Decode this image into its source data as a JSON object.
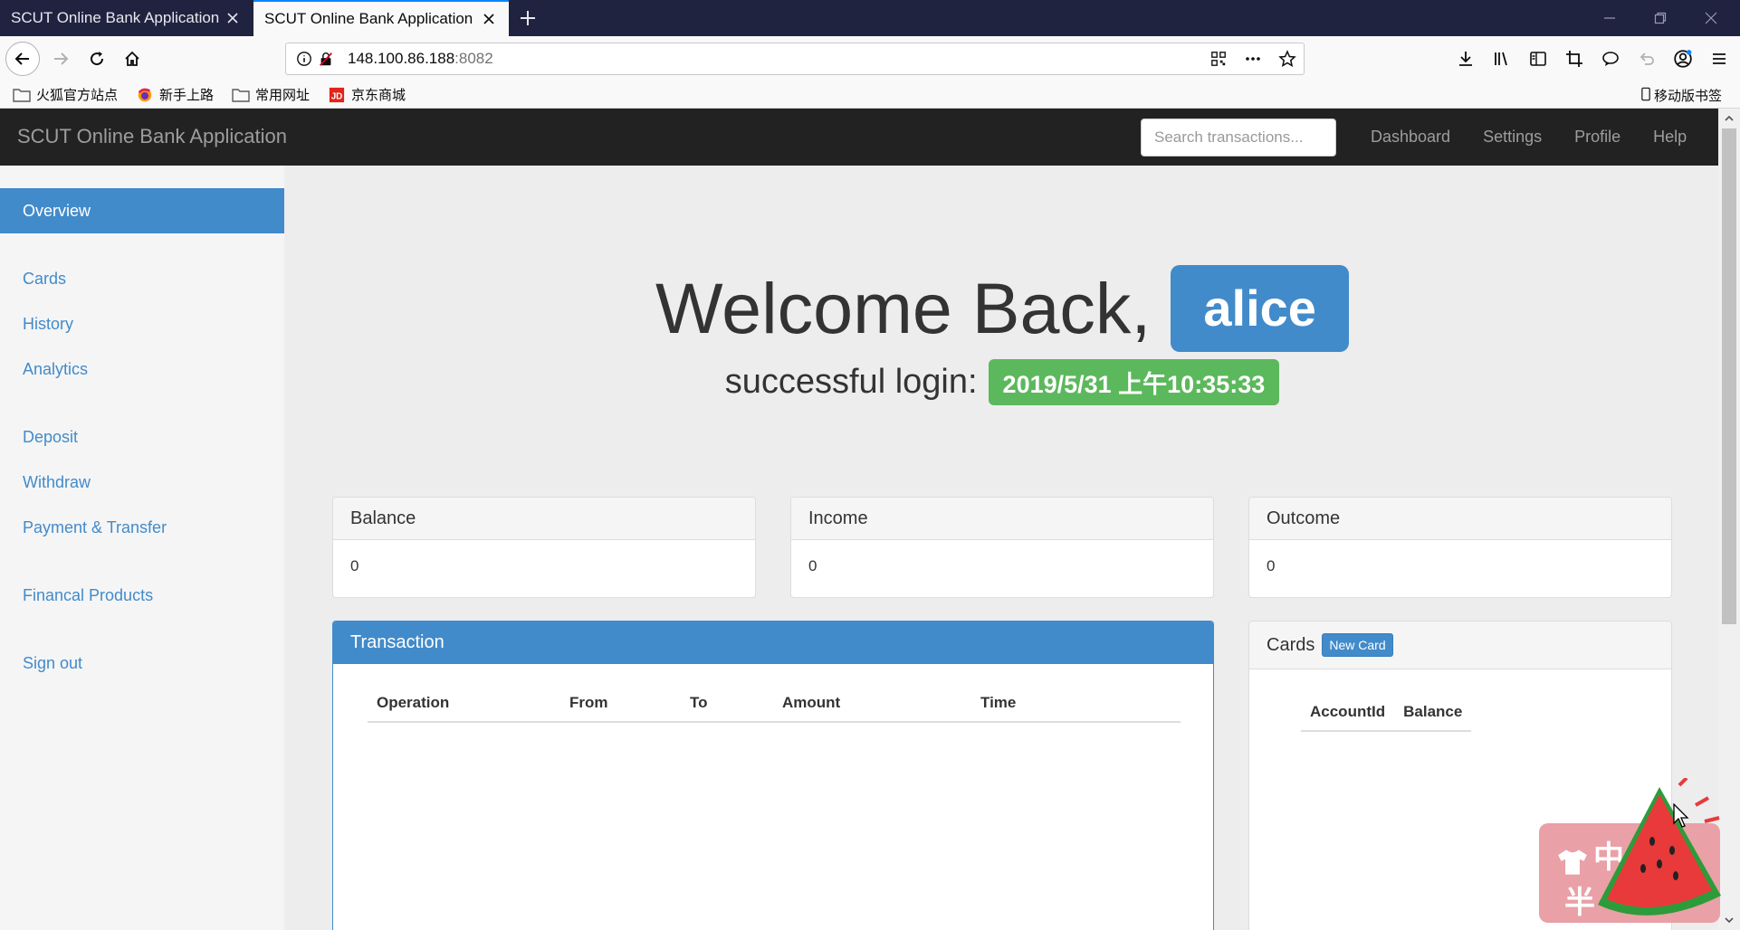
{
  "browser": {
    "tabs": [
      {
        "title": "SCUT Online Bank Application"
      },
      {
        "title": "SCUT Online Bank Application"
      }
    ],
    "url": {
      "host": "148.100.86.188",
      "port": ":8082"
    },
    "bookmarks": [
      {
        "label": "火狐官方站点",
        "icon": "folder-icon"
      },
      {
        "label": "新手上路",
        "icon": "firefox-icon"
      },
      {
        "label": "常用网址",
        "icon": "folder-icon"
      },
      {
        "label": "京东商城",
        "icon": "jd-icon"
      }
    ],
    "mobile_bookmarks": "移动版书签"
  },
  "app": {
    "brand": "SCUT Online Bank Application",
    "search_placeholder": "Search transactions...",
    "top_links": [
      "Dashboard",
      "Settings",
      "Profile",
      "Help"
    ]
  },
  "sidebar": {
    "items": [
      {
        "label": "Overview",
        "active": true
      },
      {
        "label": "Cards"
      },
      {
        "label": "History"
      },
      {
        "label": "Analytics"
      },
      {
        "label": "Deposit"
      },
      {
        "label": "Withdraw"
      },
      {
        "label": "Payment & Transfer"
      },
      {
        "label": "Financal Products"
      },
      {
        "label": "Sign out"
      }
    ]
  },
  "welcome": {
    "greeting": "Welcome Back,",
    "username": "alice",
    "login_label": "successful login:",
    "login_time": "2019/5/31 上午10:35:33"
  },
  "summary": {
    "balance": {
      "title": "Balance",
      "value": "0"
    },
    "income": {
      "title": "Income",
      "value": "0"
    },
    "outcome": {
      "title": "Outcome",
      "value": "0"
    }
  },
  "transaction": {
    "title": "Transaction",
    "columns": [
      "Operation",
      "From",
      "To",
      "Amount",
      "Time"
    ]
  },
  "cards": {
    "title": "Cards",
    "new_card_label": "New Card",
    "columns": [
      "AccountId",
      "Balance"
    ]
  },
  "widget": {
    "text_top": "中",
    "text_bottom": "半"
  },
  "colors": {
    "primary": "#428bca",
    "success": "#5cb85c",
    "navbar": "#222222"
  }
}
